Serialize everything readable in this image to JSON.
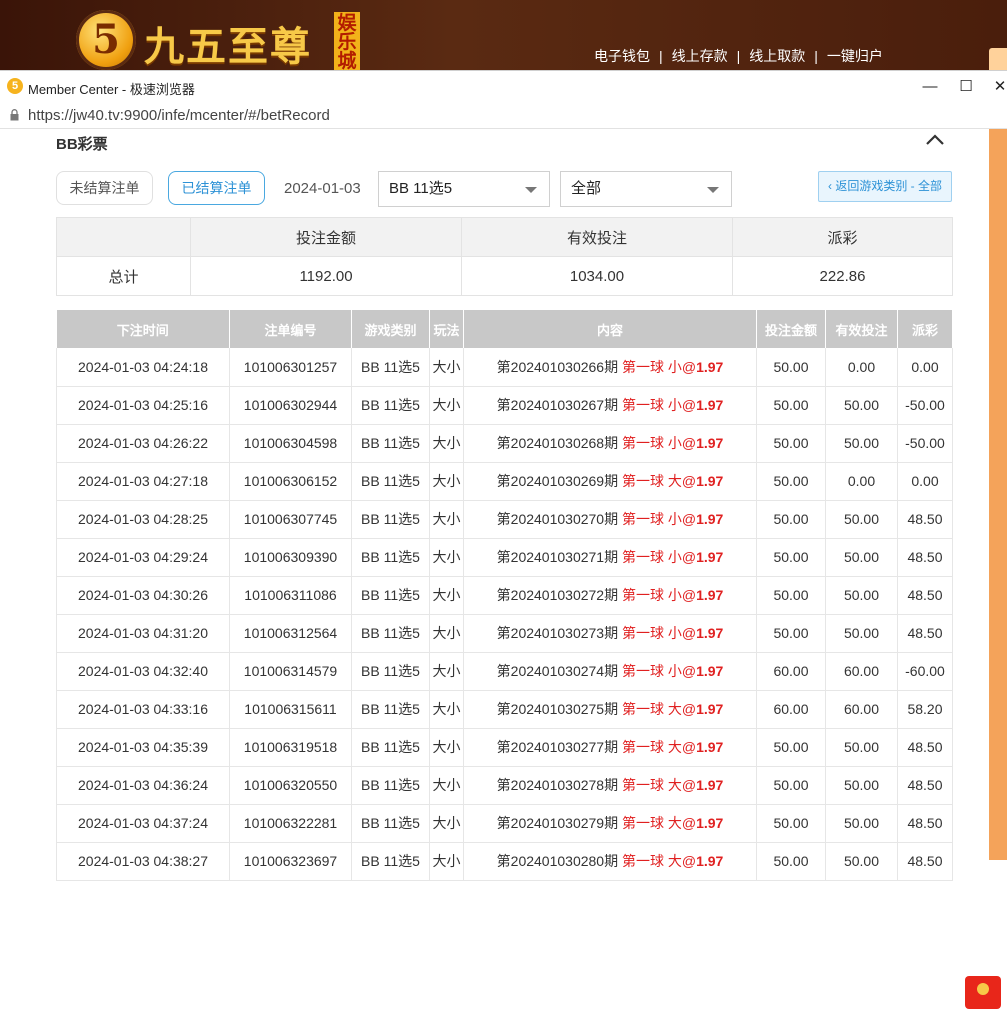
{
  "site": {
    "logo_char": "5",
    "logo_text": "九五至尊",
    "logo_sub": "娱乐城",
    "nav": [
      "电子钱包",
      "线上存款",
      "线上取款",
      "一键归户"
    ],
    "nav_sep": "|"
  },
  "browser": {
    "title": "Member Center - 极速浏览器",
    "url": "https://jw40.tv:9900/infe/mcenter/#/betRecord",
    "controls": {
      "minimize": "—",
      "maximize": "☐",
      "close": "✕"
    }
  },
  "section": {
    "title": "BB彩票"
  },
  "filters": {
    "unsettled_label": "未结算注单",
    "settled_label": "已结算注单",
    "date": "2024-01-03",
    "game_select": "BB 11选5",
    "type_select": "全部",
    "back_label": "‹ 返回游戏类别 - 全部"
  },
  "summary": {
    "headers": [
      "投注金额",
      "有效投注",
      "派彩"
    ],
    "total_label": "总计",
    "values": [
      "1192.00",
      "1034.00",
      "222.86"
    ]
  },
  "records": {
    "headers": [
      "下注时间",
      "注单编号",
      "游戏类别",
      "玩法",
      "内容",
      "投注金额",
      "有效投注",
      "派彩"
    ],
    "rows": [
      {
        "time": "2024-01-03 04:24:18",
        "id": "101006301257",
        "game": "BB 11选5",
        "play": "大小",
        "period": "第202401030266期",
        "pick": "第一球 小",
        "at": "@",
        "odds": "1.97",
        "bet": "50.00",
        "valid": "0.00",
        "payout": "0.00",
        "neg": false
      },
      {
        "time": "2024-01-03 04:25:16",
        "id": "101006302944",
        "game": "BB 11选5",
        "play": "大小",
        "period": "第202401030267期",
        "pick": "第一球 小",
        "at": "@",
        "odds": "1.97",
        "bet": "50.00",
        "valid": "50.00",
        "payout": "-50.00",
        "neg": true
      },
      {
        "time": "2024-01-03 04:26:22",
        "id": "101006304598",
        "game": "BB 11选5",
        "play": "大小",
        "period": "第202401030268期",
        "pick": "第一球 小",
        "at": "@",
        "odds": "1.97",
        "bet": "50.00",
        "valid": "50.00",
        "payout": "-50.00",
        "neg": true
      },
      {
        "time": "2024-01-03 04:27:18",
        "id": "101006306152",
        "game": "BB 11选5",
        "play": "大小",
        "period": "第202401030269期",
        "pick": "第一球 大",
        "at": "@",
        "odds": "1.97",
        "bet": "50.00",
        "valid": "0.00",
        "payout": "0.00",
        "neg": false
      },
      {
        "time": "2024-01-03 04:28:25",
        "id": "101006307745",
        "game": "BB 11选5",
        "play": "大小",
        "period": "第202401030270期",
        "pick": "第一球 小",
        "at": "@",
        "odds": "1.97",
        "bet": "50.00",
        "valid": "50.00",
        "payout": "48.50",
        "neg": false
      },
      {
        "time": "2024-01-03 04:29:24",
        "id": "101006309390",
        "game": "BB 11选5",
        "play": "大小",
        "period": "第202401030271期",
        "pick": "第一球 小",
        "at": "@",
        "odds": "1.97",
        "bet": "50.00",
        "valid": "50.00",
        "payout": "48.50",
        "neg": false
      },
      {
        "time": "2024-01-03 04:30:26",
        "id": "101006311086",
        "game": "BB 11选5",
        "play": "大小",
        "period": "第202401030272期",
        "pick": "第一球 小",
        "at": "@",
        "odds": "1.97",
        "bet": "50.00",
        "valid": "50.00",
        "payout": "48.50",
        "neg": false
      },
      {
        "time": "2024-01-03 04:31:20",
        "id": "101006312564",
        "game": "BB 11选5",
        "play": "大小",
        "period": "第202401030273期",
        "pick": "第一球 小",
        "at": "@",
        "odds": "1.97",
        "bet": "50.00",
        "valid": "50.00",
        "payout": "48.50",
        "neg": false
      },
      {
        "time": "2024-01-03 04:32:40",
        "id": "101006314579",
        "game": "BB 11选5",
        "play": "大小",
        "period": "第202401030274期",
        "pick": "第一球 小",
        "at": "@",
        "odds": "1.97",
        "bet": "60.00",
        "valid": "60.00",
        "payout": "-60.00",
        "neg": true
      },
      {
        "time": "2024-01-03 04:33:16",
        "id": "101006315611",
        "game": "BB 11选5",
        "play": "大小",
        "period": "第202401030275期",
        "pick": "第一球 大",
        "at": "@",
        "odds": "1.97",
        "bet": "60.00",
        "valid": "60.00",
        "payout": "58.20",
        "neg": false
      },
      {
        "time": "2024-01-03 04:35:39",
        "id": "101006319518",
        "game": "BB 11选5",
        "play": "大小",
        "period": "第202401030277期",
        "pick": "第一球 大",
        "at": "@",
        "odds": "1.97",
        "bet": "50.00",
        "valid": "50.00",
        "payout": "48.50",
        "neg": false
      },
      {
        "time": "2024-01-03 04:36:24",
        "id": "101006320550",
        "game": "BB 11选5",
        "play": "大小",
        "period": "第202401030278期",
        "pick": "第一球 大",
        "at": "@",
        "odds": "1.97",
        "bet": "50.00",
        "valid": "50.00",
        "payout": "48.50",
        "neg": false
      },
      {
        "time": "2024-01-03 04:37:24",
        "id": "101006322281",
        "game": "BB 11选5",
        "play": "大小",
        "period": "第202401030279期",
        "pick": "第一球 大",
        "at": "@",
        "odds": "1.97",
        "bet": "50.00",
        "valid": "50.00",
        "payout": "48.50",
        "neg": false
      },
      {
        "time": "2024-01-03 04:38:27",
        "id": "101006323697",
        "game": "BB 11选5",
        "play": "大小",
        "period": "第202401030280期",
        "pick": "第一球 大",
        "at": "@",
        "odds": "1.97",
        "bet": "50.00",
        "valid": "50.00",
        "payout": "48.50",
        "neg": false
      }
    ]
  },
  "colors": {
    "accent": "#2d92d6",
    "negative": "#e02020",
    "header_bg": "#c8c8c8"
  }
}
